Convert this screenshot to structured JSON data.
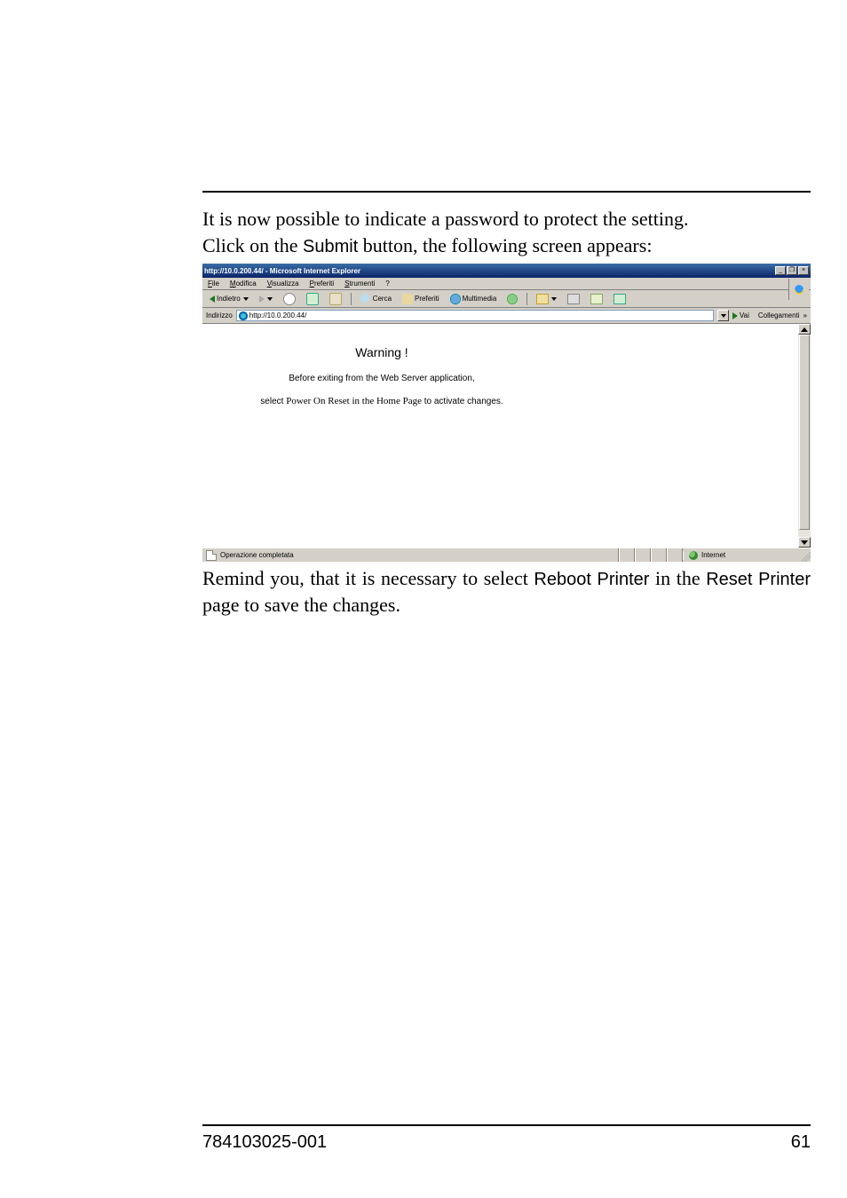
{
  "intro": {
    "line1_a": "It is now possible to indicate a password to protect the setting.",
    "line2_a": "Click on the ",
    "line2_b": "Submit",
    "line2_c": " button, the following screen appears:"
  },
  "screenshot": {
    "title": "http://10.0.200.44/ - Microsoft Internet Explorer",
    "menu": {
      "file": "File",
      "modifica": "Modifica",
      "visualizza": "Visualizza",
      "preferiti": "Preferiti",
      "strumenti": "Strumenti",
      "help": "?"
    },
    "toolbar": {
      "back": "Indietro",
      "search": "Cerca",
      "favorites": "Preferiti",
      "media": "Multimedia"
    },
    "addressbar": {
      "label": "Indirizzo",
      "value": "http://10.0.200.44/",
      "go": "Vai",
      "links": "Collegamenti",
      "chev": "»"
    },
    "content": {
      "warning_title": "Warning !",
      "warning_line1": "Before exiting from the Web Server application,",
      "warning_line2_pre": "select   ",
      "warning_line2_strong1": "Power On Reset",
      "warning_line2_mid": " in the ",
      "warning_line2_strong2": "Home Page",
      "warning_line2_post": " to activate changes."
    },
    "statusbar": {
      "left": "Operazione completata",
      "zone": "Internet"
    }
  },
  "after": {
    "a": "Remind you, that it is necessary to select ",
    "b": "Reboot Printer",
    "c": " in the ",
    "d": "Reset Printer",
    "e": " page to save the changes."
  },
  "footer": {
    "left": "784103025-001",
    "right": "61"
  }
}
